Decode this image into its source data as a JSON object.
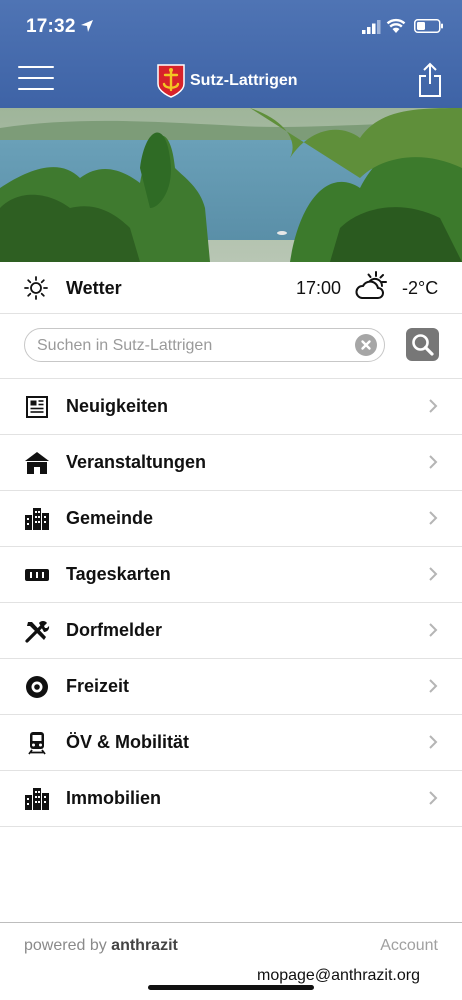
{
  "status_bar": {
    "time": "17:32"
  },
  "header": {
    "app_name": "Sutz-Lattrigen",
    "menu_icon": "hamburger-menu-icon",
    "share_icon": "share-icon"
  },
  "weather": {
    "label": "Wetter",
    "time": "17:00",
    "temperature": "-2°C",
    "left_icon": "sun-icon",
    "condition_icon": "cloud-sun-icon"
  },
  "search": {
    "placeholder": "Suchen in Sutz-Lattrigen",
    "value": ""
  },
  "menu": {
    "items": [
      {
        "label": "Neuigkeiten",
        "icon": "newspaper-icon"
      },
      {
        "label": "Veranstaltungen",
        "icon": "tent-icon"
      },
      {
        "label": "Gemeinde",
        "icon": "buildings-icon"
      },
      {
        "label": "Tageskarten",
        "icon": "ticket-icon"
      },
      {
        "label": "Dorfmelder",
        "icon": "tools-icon"
      },
      {
        "label": "Freizeit",
        "icon": "target-icon"
      },
      {
        "label": "ÖV & Mobilität",
        "icon": "train-icon"
      },
      {
        "label": "Immobilien",
        "icon": "buildings-icon"
      }
    ]
  },
  "footer": {
    "powered_prefix": "powered by",
    "powered_brand": "anthrazit",
    "account_label": "Account",
    "email": "mopage@anthrazit.org"
  },
  "colors": {
    "header": "#4a6eb0",
    "row_divider": "#e2e2e2",
    "chevron": "#b5b5b5"
  }
}
